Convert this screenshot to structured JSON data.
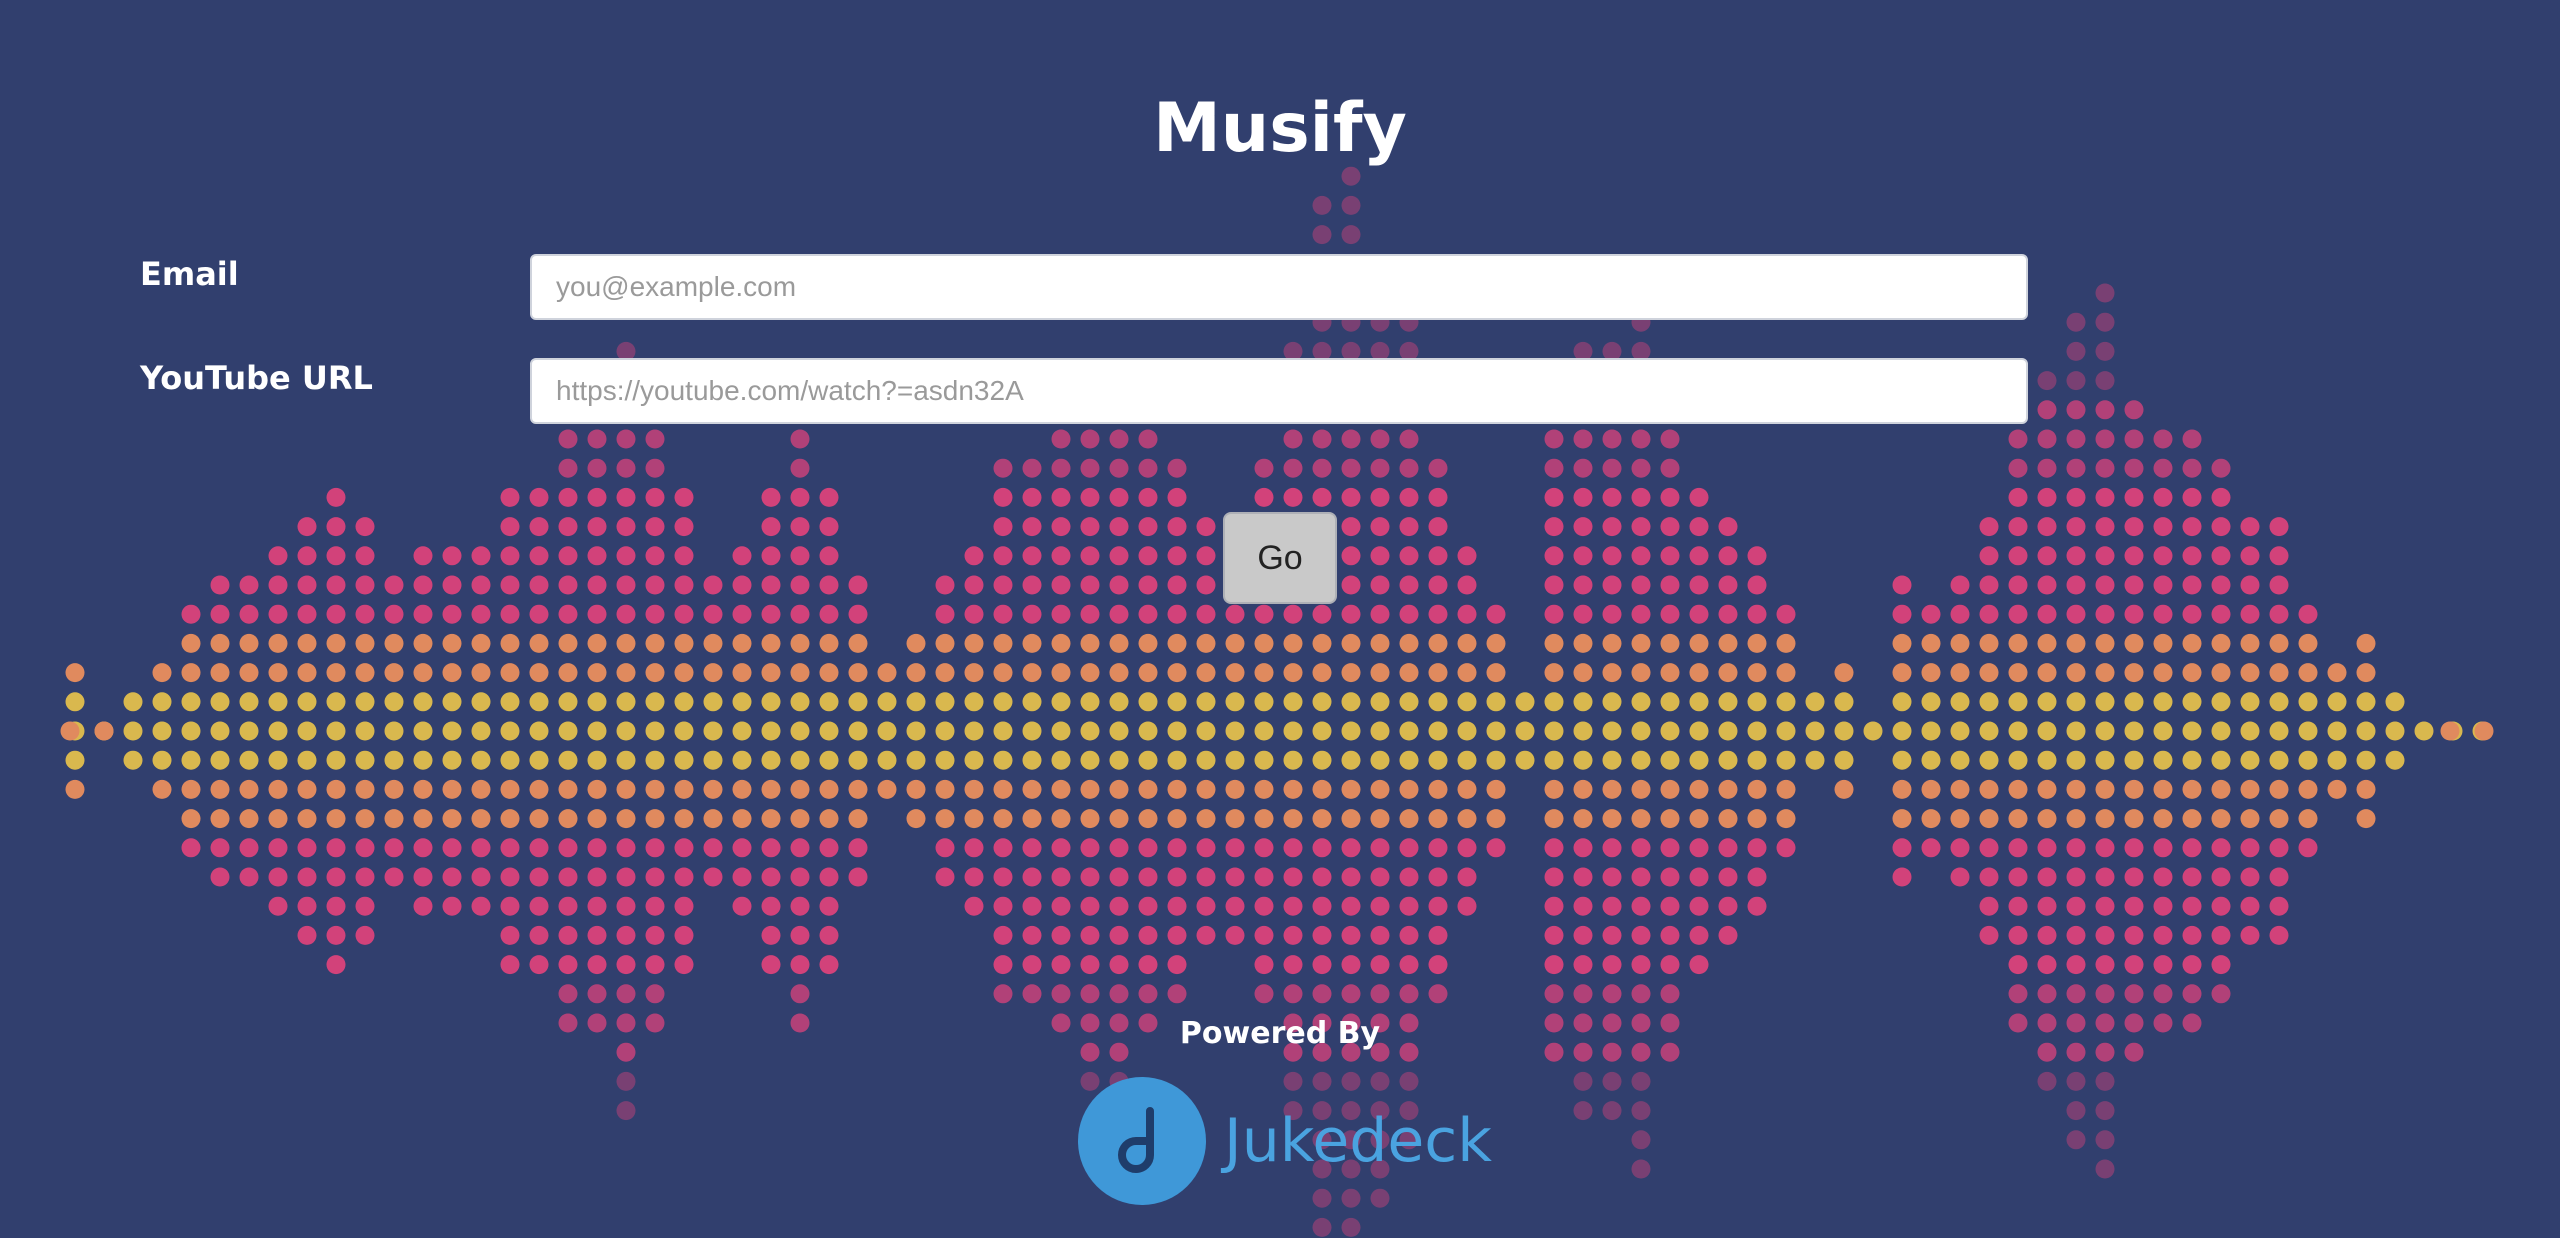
{
  "app": {
    "title": "Musify"
  },
  "form": {
    "email": {
      "label": "Email",
      "placeholder": "you@example.com"
    },
    "youtube_url": {
      "label": "YouTube URL",
      "placeholder": "https://youtube.com/watch?=asdn32A"
    },
    "submit_label": "Go"
  },
  "footer": {
    "powered_by": "Powered By",
    "brand_name": "Jukedeck",
    "brand_icon": "music-note-icon"
  },
  "background": {
    "icon": "sound-wave-dots",
    "colors": {
      "page": "#313f6e",
      "center_band": "#d9b84e",
      "mid_band": "#e08a5e",
      "outer_band": "#d2427a",
      "faded": "#7a3a72"
    }
  }
}
